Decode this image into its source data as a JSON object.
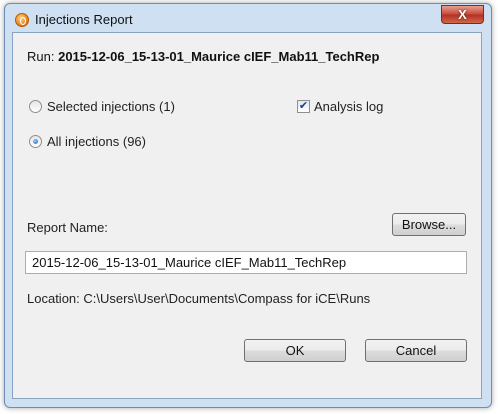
{
  "window": {
    "title": "Injections Report",
    "close_glyph": "X"
  },
  "run": {
    "label": "Run:",
    "value": "2015-12-06_15-13-01_Maurice cIEF_Mab11_TechRep"
  },
  "options": {
    "selected_injections": {
      "label": "Selected injections (1)",
      "checked": false
    },
    "all_injections": {
      "label": "All injections (96)",
      "checked": true
    },
    "analysis_log": {
      "label": "Analysis log",
      "checked": true
    }
  },
  "report": {
    "name_label": "Report Name:",
    "browse_label": "Browse...",
    "name_value": "2015-12-06_15-13-01_Maurice cIEF_Mab11_TechRep",
    "location_text": "Location: C:\\Users\\User\\Documents\\Compass for iCE\\Runs"
  },
  "buttons": {
    "ok_label": "OK",
    "cancel_label": "Cancel"
  },
  "icons": {
    "app": "compass-app-icon",
    "close": "close-icon",
    "check": "checkmark-icon"
  }
}
